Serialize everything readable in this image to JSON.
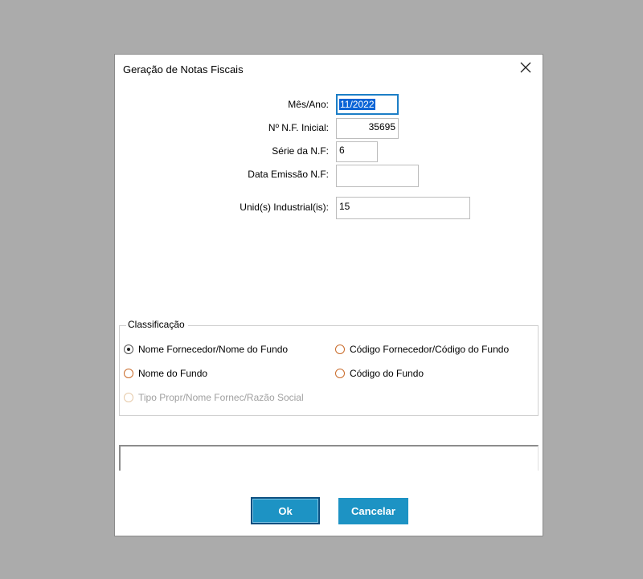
{
  "dialog": {
    "title": "Geração de Notas Fiscais",
    "close_icon": "close-icon"
  },
  "form": {
    "mes_ano_label": "Mês/Ano:",
    "mes_ano_value": "11/2022",
    "nf_inicial_label": "Nº N.F. Inicial:",
    "nf_inicial_value": "35695",
    "serie_label": "Série da N.F:",
    "serie_value": "6",
    "data_emissao_label": "Data Emissão N.F:",
    "data_emissao_value": "",
    "unid_label": "Unid(s) Industrial(is):",
    "unid_value": "15"
  },
  "classificacao": {
    "legend": "Classificação",
    "options": [
      {
        "label": "Nome Fornecedor/Nome do Fundo",
        "checked": true,
        "disabled": false
      },
      {
        "label": "Código Fornecedor/Código do Fundo",
        "checked": false,
        "disabled": false
      },
      {
        "label": "Nome do Fundo",
        "checked": false,
        "disabled": false
      },
      {
        "label": "Código do Fundo",
        "checked": false,
        "disabled": false
      },
      {
        "label": "Tipo Propr/Nome Fornec/Razão Social",
        "checked": false,
        "disabled": true
      }
    ]
  },
  "buttons": {
    "ok_label": "Ok",
    "cancel_label": "Cancelar"
  },
  "colors": {
    "background": "#ababab",
    "button": "#1d93c4",
    "focus": "#1c7ec6",
    "selection": "#0a64d6"
  }
}
